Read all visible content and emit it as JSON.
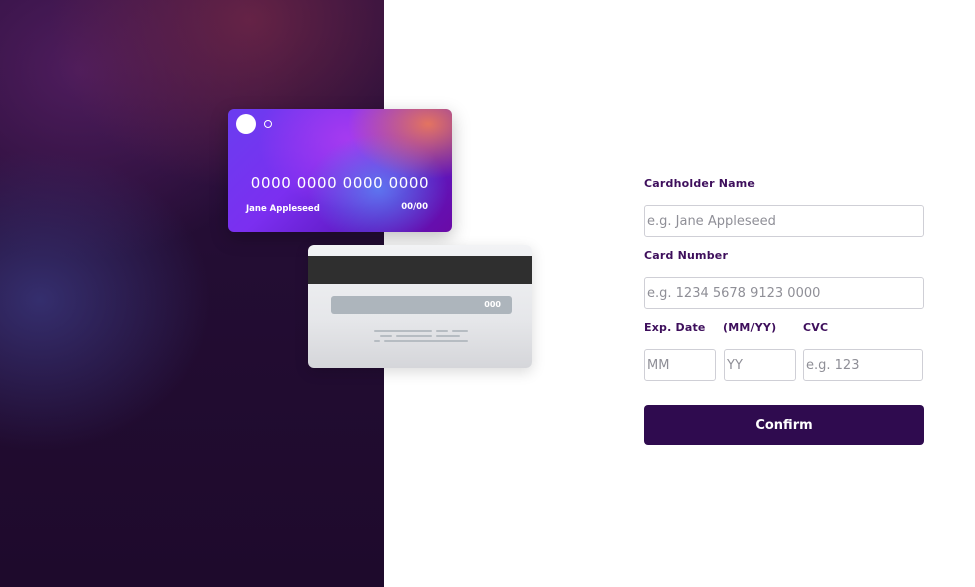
{
  "card_front": {
    "number": "0000 0000 0000 0000",
    "name": "Jane Appleseed",
    "expiry": "00/00"
  },
  "card_back": {
    "cvc": "000"
  },
  "form": {
    "name_label": "Cardholder Name",
    "name_placeholder": "e.g. Jane Appleseed",
    "number_label": "Card Number",
    "number_placeholder": "e.g. 1234 5678 9123 0000",
    "exp_label": "Exp. Date",
    "exp_format_label": "(MM/YY)",
    "month_placeholder": "MM",
    "year_placeholder": "YY",
    "cvc_label": "CVC",
    "cvc_placeholder": "e.g. 123",
    "confirm_label": "Confirm"
  },
  "colors": {
    "label": "#3e0f5c",
    "button": "#2f0b4f",
    "left_panel": "#230d33"
  }
}
